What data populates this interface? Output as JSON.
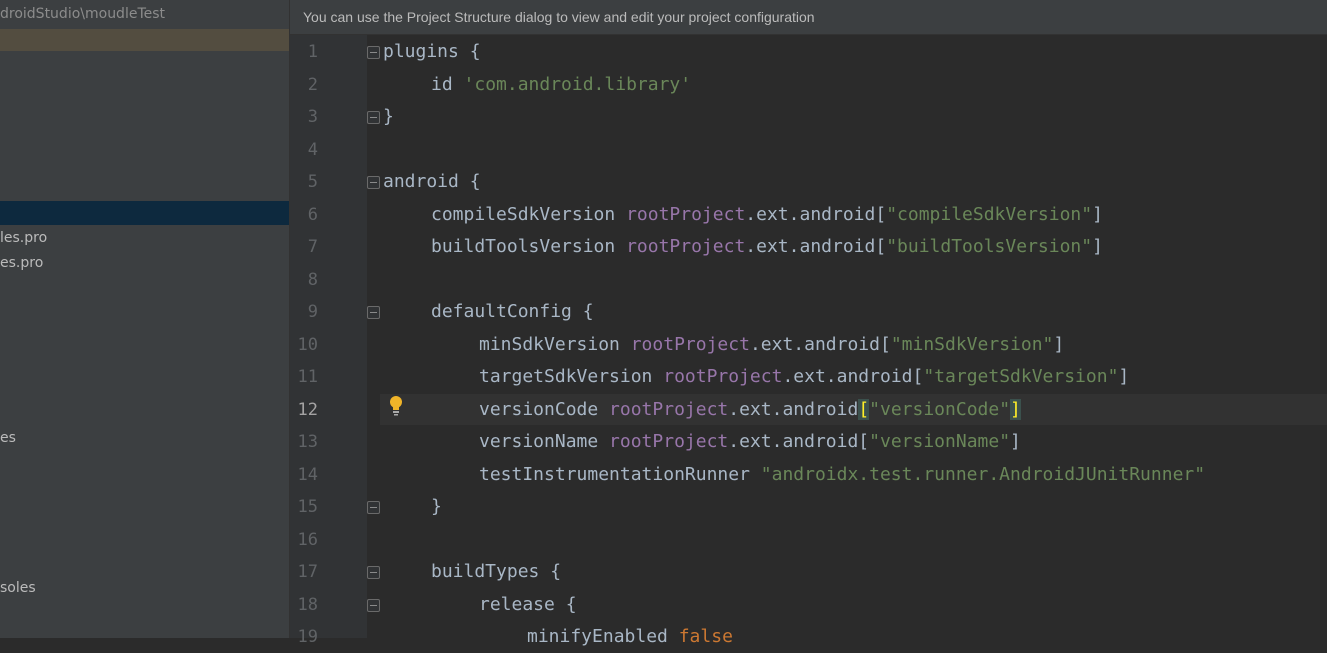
{
  "project_panel": {
    "path": "droidStudio\\moudleTest",
    "items": [
      "les.pro",
      "es.pro",
      "es",
      "soles"
    ]
  },
  "banner": {
    "text": "You can use the Project Structure dialog to view and edit your project configuration"
  },
  "editor": {
    "current_line": 12,
    "line_numbers": [
      "1",
      "2",
      "3",
      "4",
      "5",
      "6",
      "7",
      "8",
      "9",
      "10",
      "11",
      "12",
      "13",
      "14",
      "15",
      "16",
      "17",
      "18",
      "19"
    ],
    "tokens": {
      "plugins": "plugins {",
      "id_kw": "id ",
      "id_val": "'com.android.library'",
      "close1": "}",
      "android": "android {",
      "l6a": "compileSdkVersion ",
      "l6b": "rootProject",
      "l6c": ".ext.android[",
      "l6d": "\"compileSdkVersion\"",
      "l6e": "]",
      "l7a": "buildToolsVersion ",
      "l7b": "rootProject",
      "l7c": ".ext.android[",
      "l7d": "\"buildToolsVersion\"",
      "l7e": "]",
      "l9": "defaultConfig {",
      "l10a": "minSdkVersion ",
      "l10b": "rootProject",
      "l10c": ".ext.android[",
      "l10d": "\"minSdkVersion\"",
      "l10e": "]",
      "l11a": "targetSdkVersion ",
      "l11b": "rootProject",
      "l11c": ".ext.android[",
      "l11d": "\"targetSdkVersion\"",
      "l11e": "]",
      "l12a": "versionCode ",
      "l12b": "rootProject",
      "l12c": ".ext.android",
      "l12d": "[",
      "l12e": "\"versionCode\"",
      "l12f": "]",
      "l13a": "versionName ",
      "l13b": "rootProject",
      "l13c": ".ext.android[",
      "l13d": "\"versionName\"",
      "l13e": "]",
      "l14a": "testInstrumentationRunner ",
      "l14b": "\"androidx.test.runner.AndroidJUnitRunner\"",
      "l15": "}",
      "l17": "buildTypes {",
      "l18": "release {",
      "l19a": "minifyEnabled ",
      "l19b": "false"
    }
  },
  "icons": [
    "lightbulb-icon",
    "fold-marker-icon"
  ],
  "colors": {
    "string": "#6a8759",
    "property": "#9876aa",
    "keyword": "#cc7832",
    "text": "#a9b7c6",
    "bulb": "#f0b429"
  }
}
